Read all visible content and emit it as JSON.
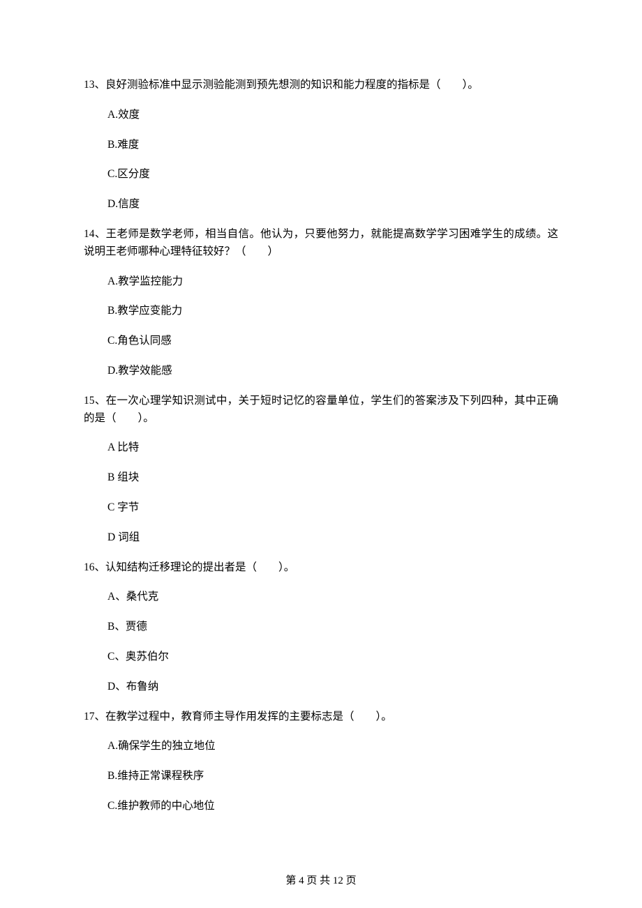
{
  "questions": [
    {
      "num": "13、",
      "text": "良好测验标准中显示测验能测到预先想测的知识和能力程度的指标是（　　）。",
      "options": [
        "A.效度",
        "B.难度",
        "C.区分度",
        "D.信度"
      ]
    },
    {
      "num": "14、",
      "text": "王老师是数学老师，相当自信。他认为，只要他努力，就能提高数学学习困难学生的成绩。这说明王老师哪种心理特征较好？（　　）",
      "options": [
        "A.教学监控能力",
        "B.教学应变能力",
        "C.角色认同感",
        "D.教学效能感"
      ]
    },
    {
      "num": "15、",
      "text": "在一次心理学知识测试中，关于短时记忆的容量单位，学生们的答案涉及下列四种，其中正确的是（　　）。",
      "options": [
        "A 比特",
        "B 组块",
        "C 字节",
        "D 词组"
      ]
    },
    {
      "num": "16、",
      "text": "认知结构迁移理论的提出者是（　　）。",
      "options": [
        "A、桑代克",
        "B、贾德",
        "C、奥苏伯尔",
        "D、布鲁纳"
      ]
    },
    {
      "num": "17、",
      "text": "在教学过程中，教育师主导作用发挥的主要标志是（　　）。",
      "options": [
        "A.确保学生的独立地位",
        "B.维持正常课程秩序",
        "C.维护教师的中心地位"
      ]
    }
  ],
  "footer": "第 4 页 共 12 页"
}
